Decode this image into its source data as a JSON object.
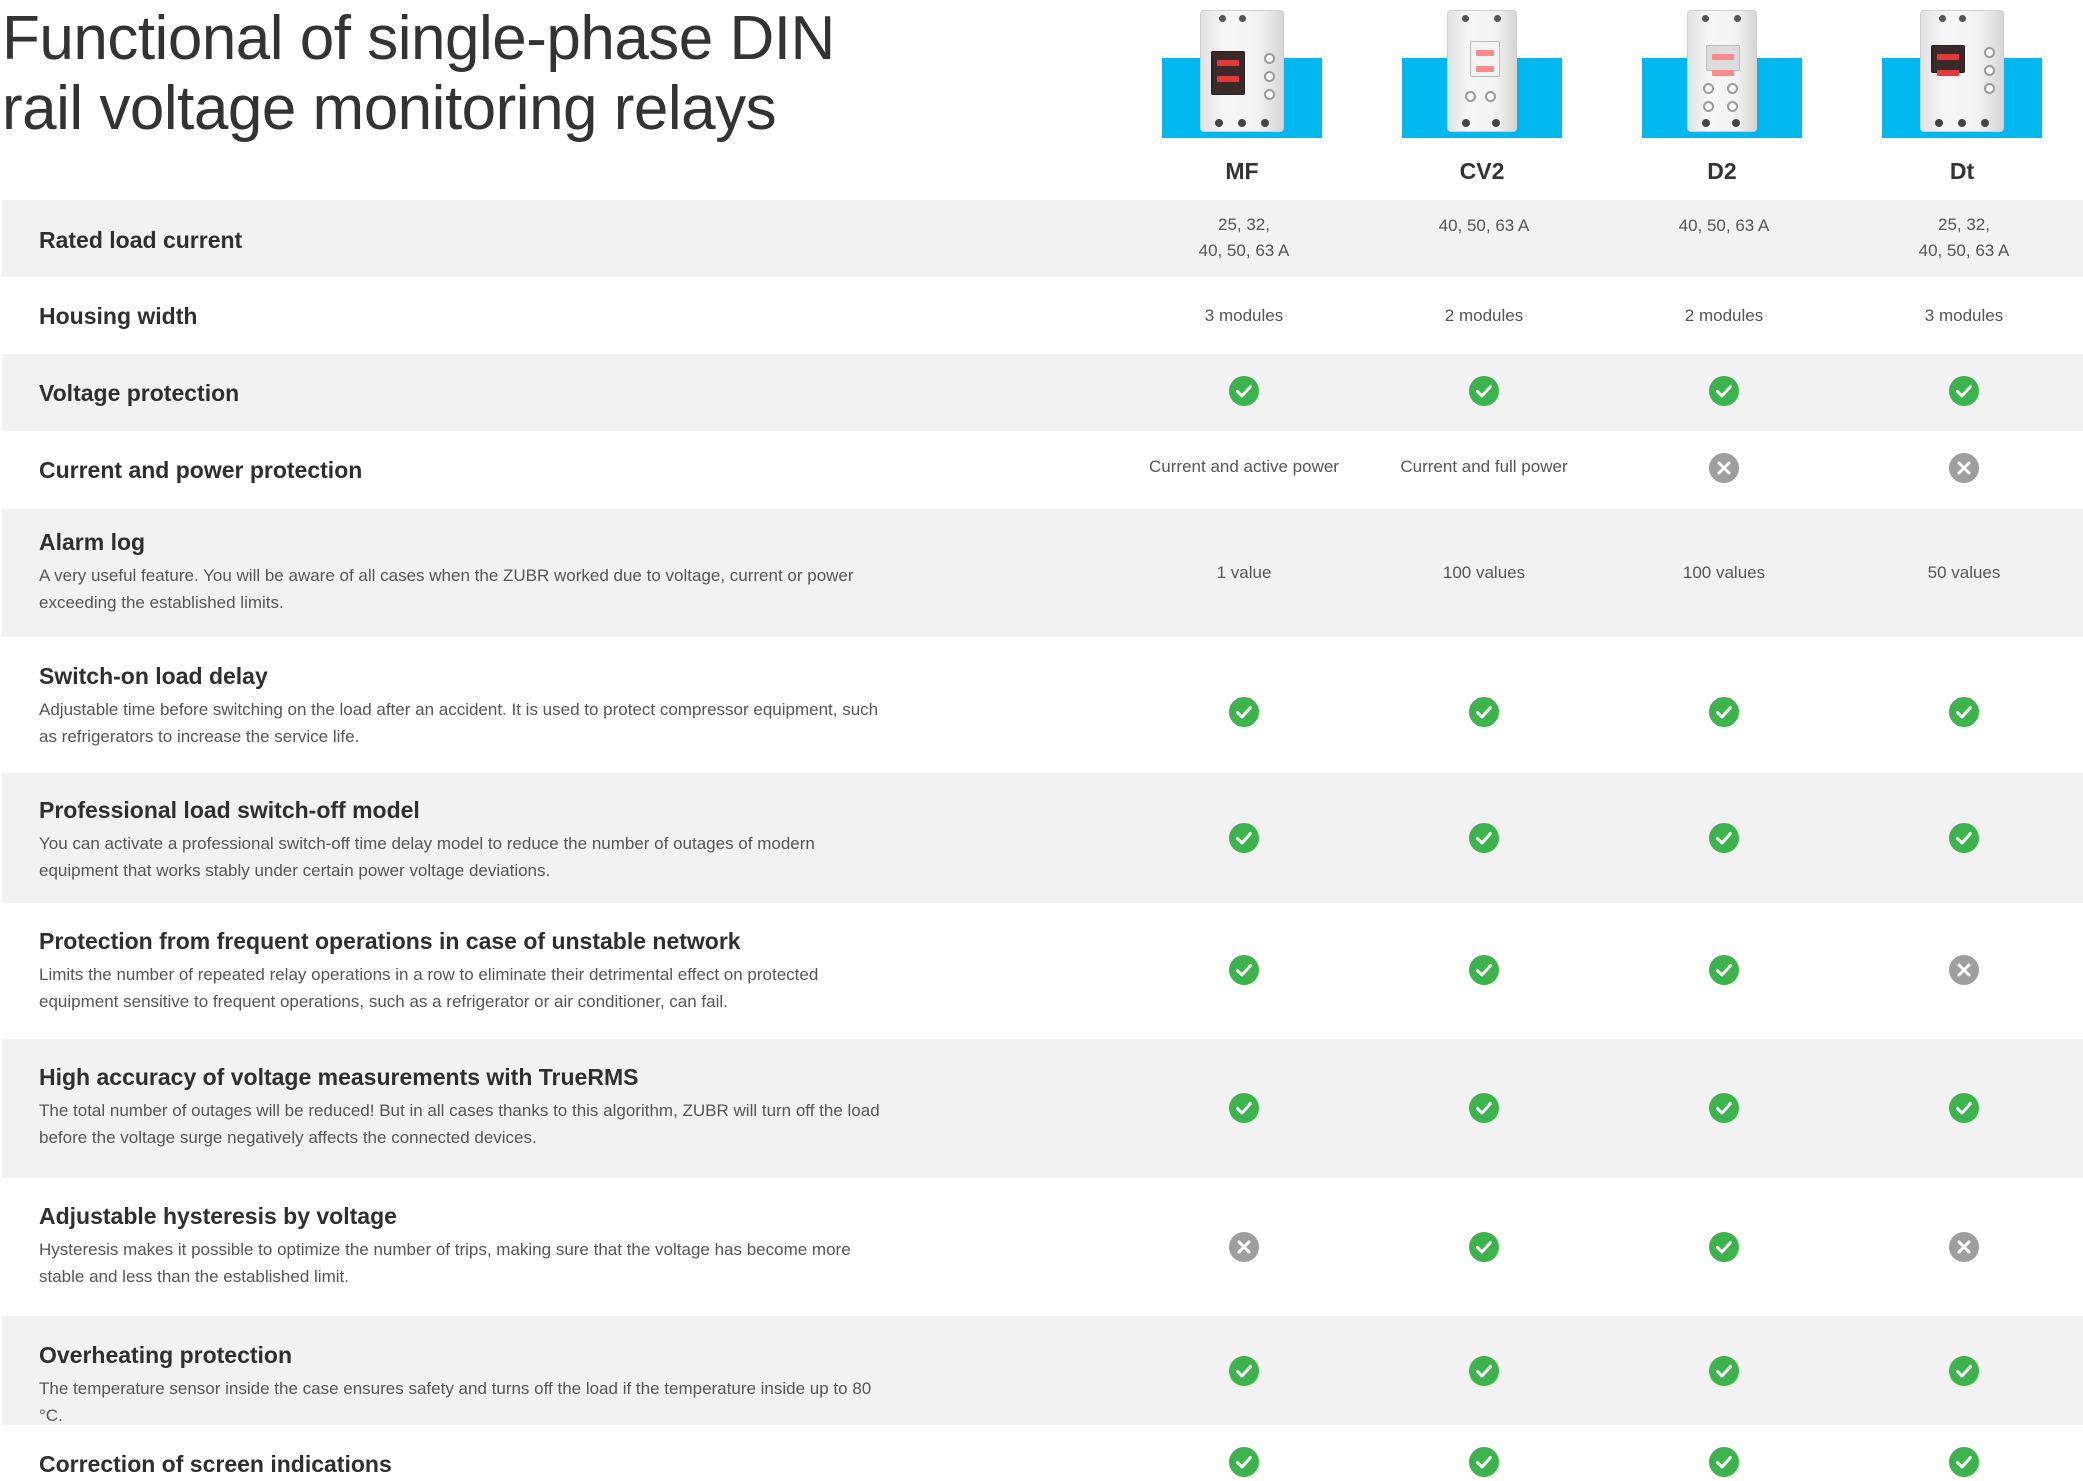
{
  "title_line1": "Functional of single-phase DIN",
  "title_line2": "rail voltage monitoring relays",
  "products": [
    {
      "name": "MF",
      "housing": "3 modules",
      "screen": "dark"
    },
    {
      "name": "CV2",
      "housing": "2 modules",
      "screen": "light"
    },
    {
      "name": "D2",
      "housing": "2 modules",
      "screen": "light"
    },
    {
      "name": "Dt",
      "housing": "3 modules",
      "screen": "dark"
    }
  ],
  "colors": {
    "check": "#3cb44b",
    "cross": "#9e9e9e",
    "product_bg": "#00b7ef",
    "row_shade": "#f2f2f2"
  },
  "rows": [
    {
      "name": "Rated load current",
      "desc": "",
      "values": [
        {
          "text": "25, 32,",
          "text2": "40, 50, 63 A"
        },
        {
          "text": "40, 50, 63 A"
        },
        {
          "text": "40, 50, 63 A"
        },
        {
          "text": "25, 32,",
          "text2": "40, 50, 63 A"
        }
      ]
    },
    {
      "name": "Housing width",
      "desc": "",
      "values": [
        {
          "text": "3 modules"
        },
        {
          "text": "2 modules"
        },
        {
          "text": "2 modules"
        },
        {
          "text": "3 modules"
        }
      ]
    },
    {
      "name": "Voltage protection",
      "desc": "",
      "values": [
        {
          "icon": "check"
        },
        {
          "icon": "check"
        },
        {
          "icon": "check"
        },
        {
          "icon": "check"
        }
      ]
    },
    {
      "name": "Current and power protection",
      "desc": "",
      "values": [
        {
          "text": "Current and active power"
        },
        {
          "text": "Current and full power"
        },
        {
          "icon": "cross"
        },
        {
          "icon": "cross"
        }
      ]
    },
    {
      "name": "Alarm log",
      "desc": "A very useful feature. You will be aware of all cases when the ZUBR worked due to voltage, current or power exceeding the established limits.",
      "values": [
        {
          "text": "1 value"
        },
        {
          "text": "100 values"
        },
        {
          "text": "100 values"
        },
        {
          "text": "50 values"
        }
      ]
    },
    {
      "name": "Switch-on load delay",
      "desc": "Adjustable time before switching on the load after an accident. It is used to protect compressor equipment, such as refrigerators to increase the service life.",
      "values": [
        {
          "icon": "check"
        },
        {
          "icon": "check"
        },
        {
          "icon": "check"
        },
        {
          "icon": "check"
        }
      ]
    },
    {
      "name": "Professional load switch-off model",
      "desc": "You can activate a professional switch-off time delay model to reduce the number of outages of modern equipment that works stably under certain power voltage deviations.",
      "values": [
        {
          "icon": "check"
        },
        {
          "icon": "check"
        },
        {
          "icon": "check"
        },
        {
          "icon": "check"
        }
      ]
    },
    {
      "name": "Protection from frequent operations in case of unstable network",
      "desc": "Limits the number of repeated relay operations in a row to eliminate their detrimental effect on protected equipment sensitive to frequent operations, such as a refrigerator or air conditioner, can fail.",
      "values": [
        {
          "icon": "check"
        },
        {
          "icon": "check"
        },
        {
          "icon": "check"
        },
        {
          "icon": "cross"
        }
      ]
    },
    {
      "name": "High accuracy of voltage measurements with TrueRMS",
      "desc": "The total number of outages will be reduced! But in all cases thanks to this algorithm, ZUBR will turn off the load before the voltage surge negatively affects the connected devices.",
      "values": [
        {
          "icon": "check"
        },
        {
          "icon": "check"
        },
        {
          "icon": "check"
        },
        {
          "icon": "check"
        }
      ]
    },
    {
      "name": "Adjustable hysteresis by voltage",
      "desc": "Hysteresis makes it possible to optimize the number of trips, making sure that the voltage has become more stable and less than the established limit.",
      "values": [
        {
          "icon": "cross"
        },
        {
          "icon": "check"
        },
        {
          "icon": "check"
        },
        {
          "icon": "cross"
        }
      ]
    },
    {
      "name": "Overheating protection",
      "desc": "The temperature sensor inside the case ensures safety and turns off the load if the temperature inside up to 80 °C.",
      "values": [
        {
          "icon": "check"
        },
        {
          "icon": "check"
        },
        {
          "icon": "check"
        },
        {
          "icon": "check"
        }
      ]
    },
    {
      "name": "Correction of screen indications",
      "desc": "",
      "values": [
        {
          "icon": "check"
        },
        {
          "icon": "check"
        },
        {
          "icon": "check"
        },
        {
          "icon": "check"
        }
      ]
    }
  ]
}
